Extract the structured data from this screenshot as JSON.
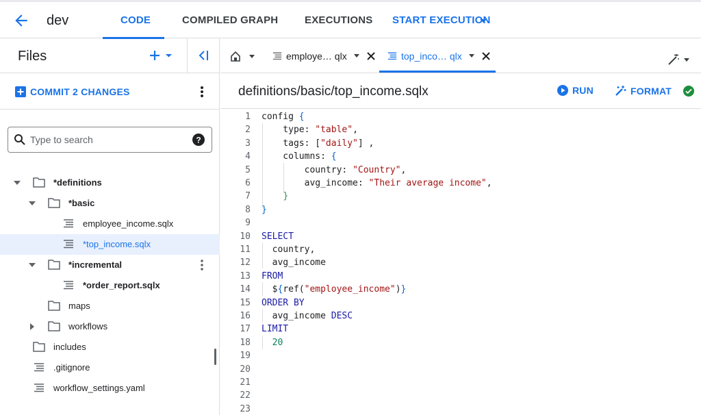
{
  "topbar": {
    "workspace": "dev",
    "tabs": [
      "CODE",
      "COMPILED GRAPH",
      "EXECUTIONS"
    ],
    "start_execution": "START EXECUTION"
  },
  "files_panel": {
    "title": "Files",
    "commit_label": "COMMIT 2 CHANGES",
    "search_placeholder": "Type to search",
    "tree": [
      {
        "label": "*definitions",
        "type": "folder",
        "expanded": true
      },
      {
        "label": "*basic",
        "type": "folder",
        "expanded": true
      },
      {
        "label": "employee_income.sqlx",
        "type": "file"
      },
      {
        "label": "*top_income.sqlx",
        "type": "file",
        "selected": true
      },
      {
        "label": "*incremental",
        "type": "folder",
        "expanded": true
      },
      {
        "label": "*order_report.sqlx",
        "type": "file"
      },
      {
        "label": "maps",
        "type": "folder"
      },
      {
        "label": "workflows",
        "type": "folder",
        "expanded": false
      },
      {
        "label": "includes",
        "type": "folder"
      },
      {
        "label": ".gitignore",
        "type": "file"
      },
      {
        "label": "workflow_settings.yaml",
        "type": "file"
      }
    ]
  },
  "editor_tabs": [
    {
      "label": "employe… qlx",
      "active": false
    },
    {
      "label": "top_inco… qlx",
      "active": true
    }
  ],
  "editor": {
    "path": "definitions/basic/top_income.sqlx",
    "run_label": "RUN",
    "format_label": "FORMAT",
    "line_numbers": [
      "1",
      "2",
      "3",
      "4",
      "5",
      "6",
      "7",
      "8",
      "9",
      "10",
      "11",
      "12",
      "13",
      "14",
      "15",
      "16",
      "17",
      "18",
      "19",
      "20",
      "21",
      "22",
      "23"
    ]
  },
  "code_lines": [
    "config {",
    "    type: \"table\",",
    "    tags: [\"daily\"] ,",
    "    columns: {",
    "        country: \"Country\",",
    "        avg_income: \"Their average income\",",
    "    }",
    "}",
    "",
    "SELECT",
    "  country,",
    "  avg_income",
    "FROM",
    "  ${ref(\"employee_income\")}",
    "ORDER BY",
    "  avg_income DESC",
    "LIMIT",
    "  20",
    "",
    "",
    "",
    "",
    ""
  ],
  "colors": {
    "accent": "#1a73e8",
    "success": "#1e8e3e",
    "keyword": "#1a1aa6",
    "string": "#a31515"
  }
}
